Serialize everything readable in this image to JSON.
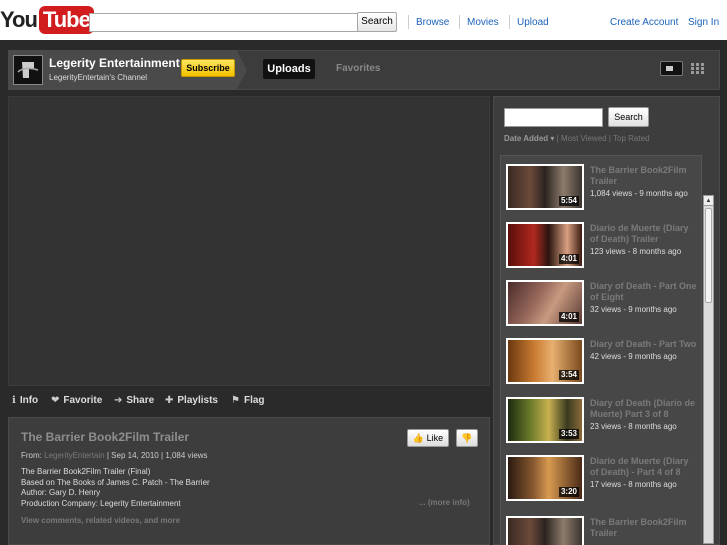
{
  "masthead": {
    "logo_you": "You",
    "logo_tube": "Tube",
    "search_label": "Search",
    "nav": [
      "Browse",
      "Movies",
      "Upload"
    ],
    "create_account": "Create Account",
    "sign_in": "Sign In"
  },
  "channel": {
    "name": "Legerity Entertainment",
    "subtitle": "LegerityEntertain's Channel",
    "subscribe_label": "Subscribe",
    "tabs": {
      "uploads": "Uploads",
      "favorites": "Favorites"
    }
  },
  "actions": {
    "info": "Info",
    "favorite": "Favorite",
    "share": "Share",
    "playlists": "Playlists",
    "flag": "Flag"
  },
  "video": {
    "title": "The Barrier Book2Film Trailer",
    "like_label": "Like",
    "from_label": "From:",
    "from_user": "LegerityEntertain",
    "date": "Sep 14, 2010",
    "views": "1,084 views",
    "description": [
      "The Barrier Book2Film Trailer (Final)",
      "Based on The Books of James C. Patch - The Barrier",
      "Author: Gary D. Henry",
      "Production Company: Legerity Entertainment"
    ],
    "more_info": "... (more info)",
    "view_comments": "View comments, related videos, and more"
  },
  "sidebar": {
    "search_label": "Search",
    "sort_options": [
      "Date Added",
      "Most Viewed",
      "Top Rated"
    ],
    "items": [
      {
        "title": "The Barrier Book2Film Trailer",
        "meta": "1,084 views - 9 months ago",
        "duration": "5:54"
      },
      {
        "title": "Diario de Muerte (Diary of Death) Trailer",
        "meta": "123 views - 8 months ago",
        "duration": "4:01"
      },
      {
        "title": "Diary of Death - Part One of Eight",
        "meta": "32 views - 9 months ago",
        "duration": "4:01"
      },
      {
        "title": "Diary of Death - Part Two",
        "meta": "42 views - 9 months ago",
        "duration": "3:54"
      },
      {
        "title": "Diary of Death (Diario de Muerte) Part 3 of 8",
        "meta": "23 views - 8 months ago",
        "duration": "3:53"
      },
      {
        "title": "Diario de Muerte (Diary of Death) - Part 4 of 8",
        "meta": "17 views - 8 months ago",
        "duration": "3:20"
      },
      {
        "title": "The Barrier Book2Film Trailer",
        "meta": "",
        "duration": ""
      }
    ]
  },
  "colors": {
    "brand_red": "#d11d1d",
    "link_blue": "#1c62b9",
    "subscribe_yellow": "#f2c100"
  }
}
